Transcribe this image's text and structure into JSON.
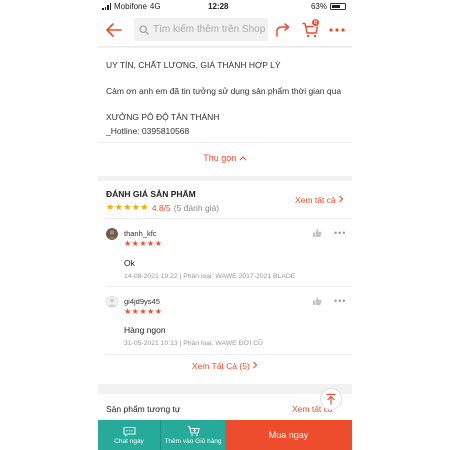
{
  "status_bar": {
    "carrier": "Mobifone",
    "network": "4G",
    "time": "12:28",
    "battery": "63%"
  },
  "header": {
    "search_placeholder": "Tìm kiếm thêm trên Shopee",
    "cart_count": "6"
  },
  "description": {
    "lines": [
      "UY TÍN, CHẤT LƯỢNG, GIÁ THÀNH HỢP LÝ",
      "Cảm ơn anh em đã tin tưởng sử dụng sản phẩm thời gian qua",
      "XƯỞNG PÔ ĐỘ TÂN THÀNH",
      "_Hotline: 0395810568"
    ],
    "collapse_label": "Thu gọn"
  },
  "reviews": {
    "title": "ĐÁNH GIÁ SẢN PHẨM",
    "stars": "★★★★★",
    "score": "4.8/5",
    "count": "(5 đánh giá)",
    "see_all": "Xem tất cả",
    "items": [
      {
        "user": "thanh_kfc",
        "stars": "★★★★★",
        "text": "Ok",
        "meta": "14-08-2021 19:22 | Phân loại: WAWE 2017-2021 BLADE"
      },
      {
        "user": "gi4jd9ys45",
        "stars": "★★★★★",
        "text": "Hàng ngon",
        "meta": "31-05-2021 10:13 | Phân loại: WAWE ĐỜI CŨ"
      }
    ],
    "see_all_bottom": "Xem Tất Cả (5)"
  },
  "similar": {
    "title": "Sản phẩm tương tự",
    "see_all": "Xem tất cả"
  },
  "bottom_bar": {
    "chat": "Chat ngay",
    "add_to_cart": "Thêm vào Giỏ hàng",
    "buy": "Mua ngay"
  },
  "colors": {
    "brand": "#ee4d2d",
    "teal": "#26aa99",
    "star": "#f6a700"
  }
}
